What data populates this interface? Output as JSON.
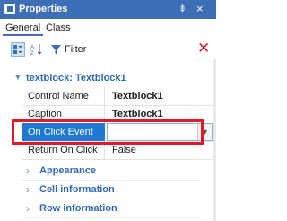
{
  "window": {
    "title": "Properties",
    "pin_glyph": "⇟",
    "close_glyph": "×"
  },
  "tabs": [
    {
      "label": "General"
    },
    {
      "label": "Class"
    }
  ],
  "toolbar": {
    "filter_label": "Filter",
    "filter_value": "",
    "clear_glyph": "✕"
  },
  "object": {
    "header": "textblock: Textblock1"
  },
  "properties": [
    {
      "name": "Control Name",
      "value": "Textblock1"
    },
    {
      "name": "Caption",
      "value": "Textblock1"
    },
    {
      "name": "On Click Event",
      "value": ""
    },
    {
      "name": "Return On Click",
      "value": "False"
    }
  ],
  "categories": [
    {
      "label": "Appearance"
    },
    {
      "label": "Cell information"
    },
    {
      "label": "Row information"
    }
  ],
  "icons": {
    "title": "properties-window-icon",
    "categorized": "categorized-view-icon",
    "alphabetical": "alphabetical-sort-icon",
    "filter": "filter-funnel-icon",
    "clear": "clear-filter-icon",
    "dropdown": "chevron-down-icon",
    "expand": "chevron-right-icon",
    "collapse": "chevron-down-icon"
  },
  "colors": {
    "accent": "#3d6fb6",
    "selection": "#1f78d4",
    "category_text": "#2f6bb0",
    "highlight": "#e1182a"
  }
}
